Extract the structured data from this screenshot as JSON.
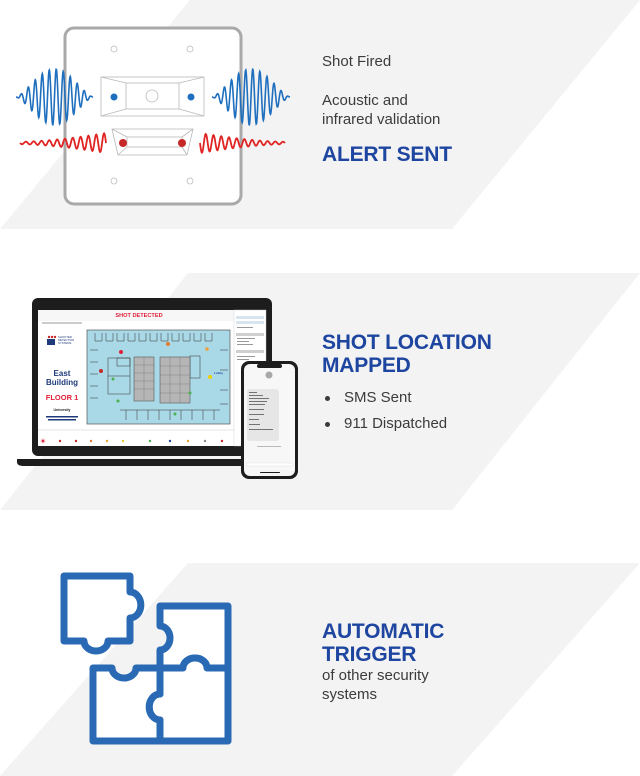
{
  "colors": {
    "panel_bg": "#f3f3f3",
    "heading_blue": "#1e46a0",
    "icon_blue": "#2a6ab5",
    "acoustic_wave_blue": "#1f6fbf",
    "infrared_wave_red": "#e02424",
    "body_text": "#3b3b3b"
  },
  "sections": [
    {
      "id": "detection",
      "illustration": "gunshot-sensor-icon",
      "lines": [
        "Shot Fired",
        "Acoustic and infrared validation"
      ],
      "line1": "Shot Fired",
      "line2a": "Acoustic and",
      "line2b": "infrared validation",
      "heading": "ALERT SENT"
    },
    {
      "id": "mapping",
      "illustration": "laptop-and-phone-dashboard",
      "heading_line1": "SHOT LOCATION",
      "heading_line2": "MAPPED",
      "bullets": [
        "SMS Sent",
        "911 Dispatched"
      ],
      "laptop_screen": {
        "banner": "SHOT DETECTED",
        "logo_text": [
          "SHOOTER",
          "DETECTION",
          "SYSTEMS"
        ],
        "building": "East Building",
        "building_line1": "East",
        "building_line2": "Building",
        "floor": "FLOOR 1",
        "org": "University",
        "map_room_label": "Lobby"
      }
    },
    {
      "id": "integration",
      "illustration": "puzzle-pieces-icon",
      "heading_line1": "AUTOMATIC",
      "heading_line2": "TRIGGER",
      "sub_line1": "of other security",
      "sub_line2": "systems"
    }
  ]
}
